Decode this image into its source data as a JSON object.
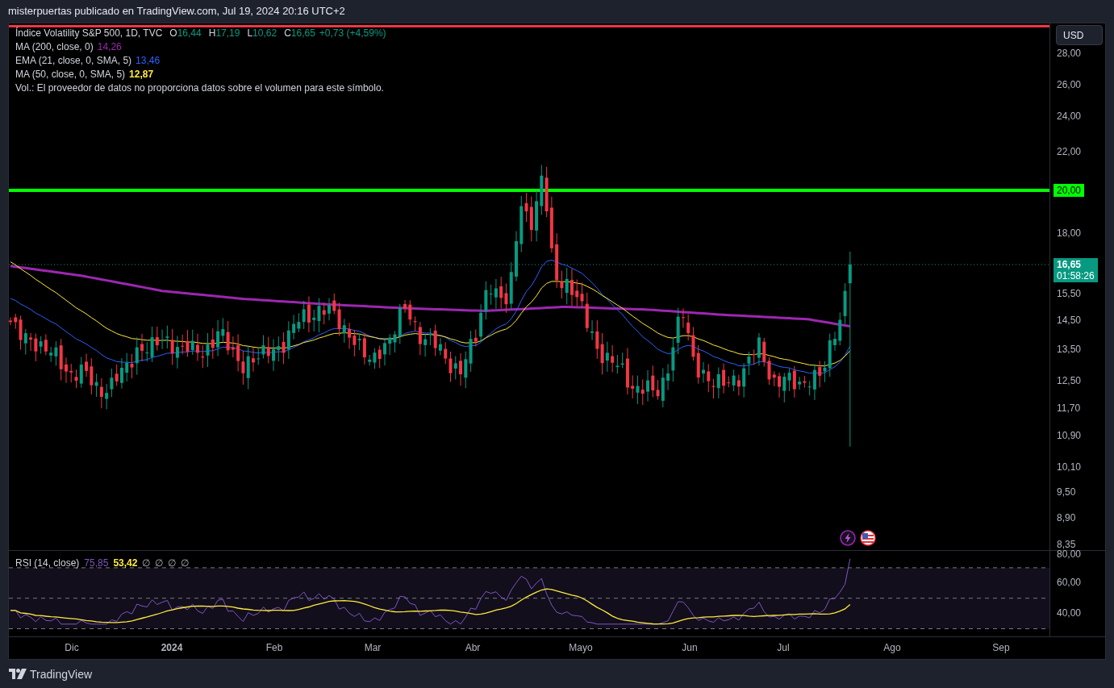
{
  "header": {
    "text": "misterpuertas publicado en TradingView.com, Jul 19, 2024 20:16 UTC+2"
  },
  "legend": {
    "symbol": "Índice Volatility S&P 500, 1D, TVC",
    "ohlc": [
      {
        "label": "O",
        "value": "16,44"
      },
      {
        "label": "H",
        "value": "17,19"
      },
      {
        "label": "L",
        "value": "10,62"
      },
      {
        "label": "C",
        "value": "16,65"
      }
    ],
    "change": "+0,73 (+4,59%)"
  },
  "indicators": [
    {
      "name": "MA (200, close, 0)",
      "value": "14,26",
      "color": "#9c27b0"
    },
    {
      "name": "EMA (21, close, 0, SMA, 5)",
      "value": "13,46",
      "color": "#2962ff"
    },
    {
      "name": "MA (50, close, 0, SMA, 5)",
      "value": "12,87",
      "color": "#ffeb3b"
    }
  ],
  "volume_note": "Vol.: El proveedor de datos no proporciona datos sobre el volumen para este símbolo.",
  "currency_button": "USD",
  "price_axis": [
    "28,00",
    "26,00",
    "24,00",
    "22,00",
    "18,00",
    "15,50",
    "14,50",
    "13,50",
    "12,50",
    "11,70",
    "10,90",
    "10,10",
    "9,50",
    "8,90",
    "8,35"
  ],
  "level_line": {
    "label": "20,00"
  },
  "last_price": {
    "price": "16,65",
    "countdown": "01:58:26"
  },
  "rsi": {
    "name": "RSI (14, close)",
    "values": [
      {
        "value": "75,85",
        "color": "#7e57c2"
      },
      {
        "value": "53,42",
        "color": "#ffeb3b"
      }
    ],
    "empty_values": [
      "∅",
      "∅",
      "∅",
      "∅"
    ],
    "axis": [
      "80,00",
      "60,00",
      "40,00"
    ]
  },
  "time_axis": [
    {
      "label": "Dic",
      "kind": "month"
    },
    {
      "label": "2024",
      "kind": "year"
    },
    {
      "label": "Feb",
      "kind": "month"
    },
    {
      "label": "Mar",
      "kind": "month"
    },
    {
      "label": "Abr",
      "kind": "month"
    },
    {
      "label": "Mayo",
      "kind": "month"
    },
    {
      "label": "Jun",
      "kind": "month"
    },
    {
      "label": "Jul",
      "kind": "month"
    },
    {
      "label": "Ago",
      "kind": "month"
    },
    {
      "label": "Sep",
      "kind": "month"
    }
  ],
  "footer": {
    "brand": "TradingView"
  }
}
